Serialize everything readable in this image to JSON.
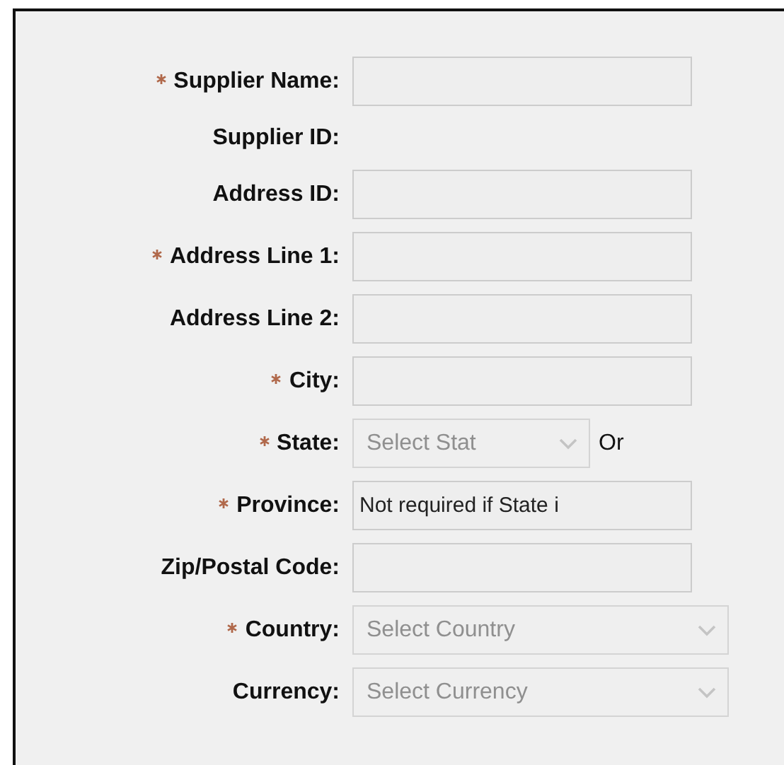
{
  "fields": [
    {
      "label": "Supplier Name:",
      "required": true,
      "kind": "text"
    },
    {
      "label": "Supplier ID:",
      "required": false,
      "kind": "static"
    },
    {
      "label": "Address ID:",
      "required": false,
      "kind": "text"
    },
    {
      "label": "Address Line 1:",
      "required": true,
      "kind": "text"
    },
    {
      "label": "Address Line 2:",
      "required": false,
      "kind": "text"
    },
    {
      "label": "City:",
      "required": true,
      "kind": "text"
    },
    {
      "label": "State:",
      "required": true,
      "kind": "select",
      "placeholder": "Select Stat",
      "after": "Or"
    },
    {
      "label": "Province:",
      "required": true,
      "kind": "text",
      "value": "Not required if State i"
    },
    {
      "label": "Zip/Postal Code:",
      "required": false,
      "kind": "text"
    },
    {
      "label": "Country:",
      "required": true,
      "kind": "select",
      "placeholder": "Select Country"
    },
    {
      "label": "Currency:",
      "required": false,
      "kind": "select",
      "placeholder": "Select Currency"
    }
  ]
}
